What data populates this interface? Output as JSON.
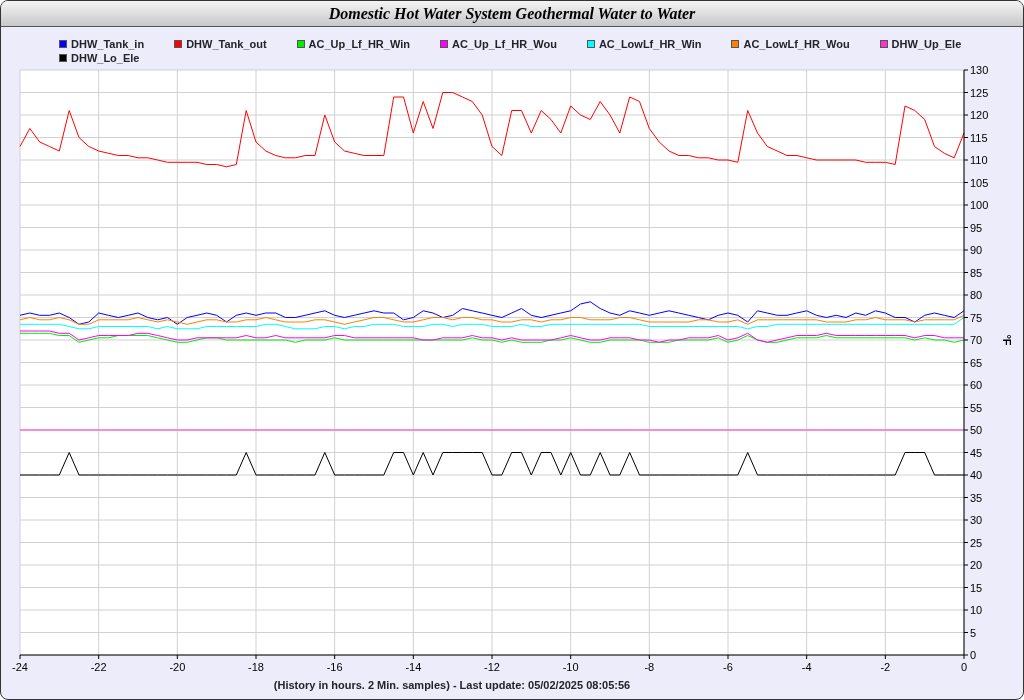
{
  "panel": {
    "chart_data": {
      "type": "line",
      "title": "Domestic Hot Water System Geothermal Water to Water",
      "xlabel": "(History in hours. 2 Min. samples) - Last update: 05/02/2025 08:05:56",
      "ylabel": "°F",
      "x": [
        -24,
        -23.75,
        -23.5,
        -23.25,
        -23,
        -22.75,
        -22.5,
        -22.25,
        -22,
        -21.75,
        -21.5,
        -21.25,
        -21,
        -20.75,
        -20.5,
        -20.25,
        -20,
        -19.75,
        -19.5,
        -19.25,
        -19,
        -18.75,
        -18.5,
        -18.25,
        -18,
        -17.75,
        -17.5,
        -17.25,
        -17,
        -16.75,
        -16.5,
        -16.25,
        -16,
        -15.75,
        -15.5,
        -15.25,
        -15,
        -14.75,
        -14.5,
        -14.25,
        -14,
        -13.75,
        -13.5,
        -13.25,
        -13,
        -12.75,
        -12.5,
        -12.25,
        -12,
        -11.75,
        -11.5,
        -11.25,
        -11,
        -10.75,
        -10.5,
        -10.25,
        -10,
        -9.75,
        -9.5,
        -9.25,
        -9,
        -8.75,
        -8.5,
        -8.25,
        -8,
        -7.75,
        -7.5,
        -7.25,
        -7,
        -6.75,
        -6.5,
        -6.25,
        -6,
        -5.75,
        -5.5,
        -5.25,
        -5,
        -4.75,
        -4.5,
        -4.25,
        -4,
        -3.75,
        -3.5,
        -3.25,
        -3,
        -2.75,
        -2.5,
        -2.25,
        -2,
        -1.75,
        -1.5,
        -1.25,
        -1,
        -0.75,
        -0.5,
        -0.25,
        0
      ],
      "series": [
        {
          "name": "DHW_Tank_in",
          "color": "#0000ff",
          "values": [
            75.5,
            76,
            75.5,
            75.5,
            76,
            75,
            73.5,
            74,
            76,
            75.5,
            75,
            75.5,
            76,
            75,
            74.5,
            75,
            73.5,
            75,
            75.5,
            76,
            75.5,
            74,
            75.5,
            76,
            75.5,
            76,
            76,
            75,
            75,
            75.5,
            76,
            76.5,
            75.5,
            75,
            75.5,
            76,
            76.5,
            76,
            76,
            74.5,
            75,
            76.5,
            76,
            75,
            75.5,
            77,
            76.5,
            76,
            75.5,
            75,
            76,
            77,
            75.5,
            75,
            75.5,
            76,
            76.5,
            78,
            78.5,
            77,
            76,
            75.5,
            76.5,
            76,
            75.5,
            76,
            76.5,
            76,
            75.5,
            75,
            74.5,
            75.5,
            76,
            75.5,
            74,
            76.5,
            76,
            75.5,
            75.5,
            76,
            76.5,
            75.5,
            75,
            75.5,
            75,
            76,
            75.5,
            76.5,
            76,
            75,
            75,
            74,
            75.5,
            76,
            75.5,
            75,
            76.5
          ]
        },
        {
          "name": "DHW_Tank_out",
          "color": "#ff0000",
          "values": [
            113,
            117,
            114,
            113,
            112,
            121,
            115,
            113,
            112,
            111.5,
            111,
            111,
            110.5,
            110.5,
            110,
            109.5,
            109.5,
            109.5,
            109.5,
            109,
            109,
            108.5,
            109,
            121,
            114,
            112,
            111,
            110.5,
            110.5,
            111,
            111,
            120,
            114,
            112,
            111.5,
            111,
            111,
            111,
            124,
            124,
            116,
            123,
            117,
            125,
            125,
            124,
            123,
            120,
            113,
            111,
            121,
            121,
            116,
            121,
            119,
            116,
            122,
            120,
            119,
            123,
            120,
            116,
            124,
            123,
            117,
            114,
            112,
            111,
            111,
            110.5,
            110.5,
            110,
            110,
            109.5,
            121,
            116,
            113,
            112,
            111,
            111,
            110.5,
            110,
            110,
            110,
            110,
            110,
            109.5,
            109.5,
            109.5,
            109,
            122,
            121,
            119,
            113,
            111.5,
            110.5,
            116
          ]
        },
        {
          "name": "AC_Up_Lf_HR_Win",
          "color": "#00ee00",
          "values": [
            71.5,
            71.5,
            71.5,
            71.5,
            71,
            71,
            69.5,
            70,
            70.5,
            70.5,
            71,
            71,
            71,
            71,
            70.5,
            70,
            69.5,
            69.5,
            70,
            70.5,
            70.5,
            70,
            70,
            70,
            70,
            70,
            70,
            70,
            69.5,
            70,
            70,
            70,
            70.5,
            70,
            70,
            70,
            70,
            70,
            70,
            70,
            70,
            70,
            70,
            70,
            70,
            70,
            70.5,
            70,
            70,
            69.5,
            70,
            69.5,
            69.5,
            69.5,
            70,
            70,
            70.5,
            70,
            69.5,
            69.5,
            70,
            70,
            70,
            70,
            69.5,
            69.5,
            69.5,
            70,
            70,
            70,
            70,
            70.5,
            69.5,
            70,
            71,
            70,
            69.5,
            69.5,
            70,
            70.5,
            70.5,
            70.5,
            71,
            70.5,
            70.5,
            70.5,
            70.5,
            70.5,
            70.5,
            70.5,
            70.5,
            70,
            70.5,
            70,
            70,
            69.5,
            70
          ]
        },
        {
          "name": "AC_Up_Lf_HR_Wou",
          "color": "#ff00ff",
          "values": [
            72,
            72,
            72,
            72,
            71.5,
            71.5,
            70,
            70.5,
            71,
            71,
            71,
            71,
            71.5,
            71.5,
            71,
            70.5,
            70,
            70,
            70.5,
            70.5,
            70.5,
            70.5,
            70.5,
            71,
            70.5,
            70.5,
            71,
            70.5,
            70.5,
            70.5,
            70.5,
            70.5,
            71,
            71,
            70.5,
            70.5,
            70.5,
            70.5,
            70.5,
            70.5,
            70.5,
            70,
            70,
            70.5,
            70.5,
            70.5,
            71,
            70.5,
            70.5,
            70,
            70.5,
            70,
            70,
            70,
            70,
            70.5,
            71,
            70.5,
            70,
            70,
            70.5,
            70.5,
            70.5,
            70,
            70,
            69.5,
            70,
            70,
            70.5,
            70.5,
            70.5,
            71,
            70,
            70.5,
            71.5,
            70,
            69.5,
            70,
            70.5,
            71,
            71,
            71,
            71.5,
            71,
            71,
            71,
            71,
            71,
            71,
            71,
            71,
            70.5,
            71,
            71,
            70.5,
            70.5,
            70.5
          ]
        },
        {
          "name": "AC_LowLf_HR_Win",
          "color": "#00ffff",
          "values": [
            73.5,
            73.5,
            73.5,
            73.5,
            73.5,
            73,
            72.5,
            72.5,
            73,
            73,
            73,
            73,
            73,
            73,
            72.5,
            73,
            72.5,
            72.5,
            72.5,
            73,
            73,
            73,
            73,
            73,
            73,
            73.5,
            73.5,
            73,
            72.5,
            72.5,
            72.5,
            73,
            73,
            72.5,
            73,
            73,
            73.5,
            73.5,
            73.5,
            73,
            73,
            73,
            73.5,
            73.5,
            73,
            73.5,
            73.5,
            73.5,
            73,
            73,
            73,
            73.5,
            73,
            73,
            73.5,
            73.5,
            73.5,
            73.5,
            73.5,
            73.5,
            73.5,
            73.5,
            73.5,
            73.5,
            73,
            73,
            73,
            73,
            73,
            73,
            73,
            73,
            73,
            73,
            72.5,
            73,
            73,
            73.5,
            73.5,
            73.5,
            73.5,
            73.5,
            73.5,
            73.5,
            73.5,
            73.5,
            73.5,
            73.5,
            73.5,
            73.5,
            73.5,
            73.5,
            73.5,
            73.5,
            73.5,
            73.5,
            75
          ]
        },
        {
          "name": "AC_LowLf_HR_Wou",
          "color": "#ff8000",
          "values": [
            74.5,
            75,
            74.5,
            74.5,
            75,
            74.5,
            73.5,
            73.5,
            74.5,
            74.5,
            74.5,
            74.5,
            75,
            74.5,
            74,
            74.5,
            74,
            73.5,
            74,
            74.5,
            74.5,
            74,
            74,
            74.5,
            74.5,
            75,
            74.5,
            74,
            74,
            74,
            74.5,
            74.5,
            74,
            73.5,
            74,
            74.5,
            75,
            75,
            74.5,
            74,
            74,
            74.5,
            75,
            75,
            74.5,
            75,
            75,
            74.5,
            74.5,
            74,
            74,
            74.5,
            74.5,
            74,
            74.5,
            74.5,
            75,
            75,
            74.5,
            74.5,
            74.5,
            75,
            75,
            74.5,
            74,
            74,
            74,
            74,
            74,
            74.5,
            74.5,
            74,
            74,
            74.5,
            73.5,
            74.5,
            74.5,
            74.5,
            74.5,
            74.5,
            74.5,
            74.5,
            74,
            74,
            74,
            74.5,
            74.5,
            75,
            74.5,
            74.5,
            74.5,
            74,
            74.5,
            74.5,
            74.5,
            74.5,
            75.5
          ]
        },
        {
          "name": "DHW_Up_Ele",
          "color": "#ff33cc",
          "values": [
            50,
            50,
            50,
            50,
            50,
            50,
            50,
            50,
            50,
            50,
            50,
            50,
            50,
            50,
            50,
            50,
            50,
            50,
            50,
            50,
            50,
            50,
            50,
            50,
            50,
            50,
            50,
            50,
            50,
            50,
            50,
            50,
            50,
            50,
            50,
            50,
            50,
            50,
            50,
            50,
            50,
            50,
            50,
            50,
            50,
            50,
            50,
            50,
            50,
            50,
            50,
            50,
            50,
            50,
            50,
            50,
            50,
            50,
            50,
            50,
            50,
            50,
            50,
            50,
            50,
            50,
            50,
            50,
            50,
            50,
            50,
            50,
            50,
            50,
            50,
            50,
            50,
            50,
            50,
            50,
            50,
            50,
            50,
            50,
            50,
            50,
            50,
            50,
            50,
            50,
            50,
            50,
            50,
            50,
            50,
            50,
            50
          ]
        },
        {
          "name": "DHW_Lo_Ele",
          "color": "#000000",
          "values": [
            40,
            40,
            40,
            40,
            40,
            45,
            40,
            40,
            40,
            40,
            40,
            40,
            40,
            40,
            40,
            40,
            40,
            40,
            40,
            40,
            40,
            40,
            40,
            45,
            40,
            40,
            40,
            40,
            40,
            40,
            40,
            45,
            40,
            40,
            40,
            40,
            40,
            40,
            45,
            45,
            40,
            45,
            40,
            45,
            45,
            45,
            45,
            45,
            40,
            40,
            45,
            45,
            40,
            45,
            45,
            40,
            45,
            40,
            40,
            45,
            40,
            40,
            45,
            40,
            40,
            40,
            40,
            40,
            40,
            40,
            40,
            40,
            40,
            40,
            45,
            40,
            40,
            40,
            40,
            40,
            40,
            40,
            40,
            40,
            40,
            40,
            40,
            40,
            40,
            40,
            45,
            45,
            45,
            40,
            40,
            40,
            40
          ]
        }
      ],
      "grid": true,
      "xlim": [
        -24,
        0
      ],
      "ylim": [
        0,
        130
      ],
      "xticks": [
        -24,
        -22,
        -20,
        -18,
        -16,
        -14,
        -12,
        -10,
        -8,
        -6,
        -4,
        -2,
        0
      ],
      "yticks": [
        0,
        5,
        10,
        15,
        20,
        25,
        30,
        35,
        40,
        45,
        50,
        55,
        60,
        65,
        70,
        75,
        80,
        85,
        90,
        95,
        100,
        105,
        110,
        115,
        120,
        125,
        130
      ]
    }
  }
}
